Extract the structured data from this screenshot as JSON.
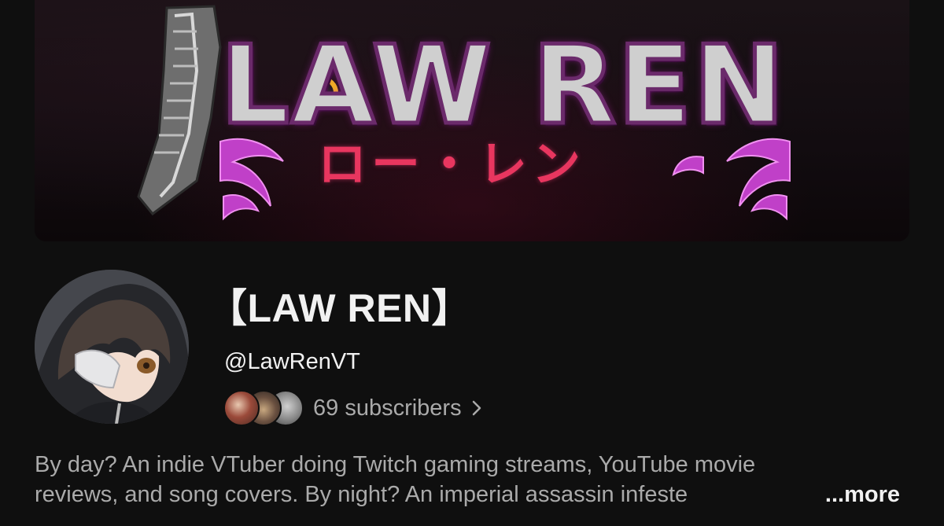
{
  "banner": {
    "title": "LAW REN",
    "subtitle": "ロー・レン"
  },
  "channel": {
    "name": "【LAW REN】",
    "handle": "@LawRenVT",
    "subscribers_text": "69 subscribers",
    "subscribers_chevron_icon": "chevron-right-icon",
    "description_line1": "By day? An indie VTuber doing Twitch gaming streams, YouTube movie",
    "description_line2": "reviews, and song covers. By night? An imperial assassin infeste",
    "more_label": "...more"
  },
  "colors": {
    "background": "#0f0f0f",
    "primary_text": "#f1f1f1",
    "secondary_text": "#aaaaaa",
    "banner_accent_pink": "#e8365f",
    "banner_accent_purple": "#c040c8"
  }
}
